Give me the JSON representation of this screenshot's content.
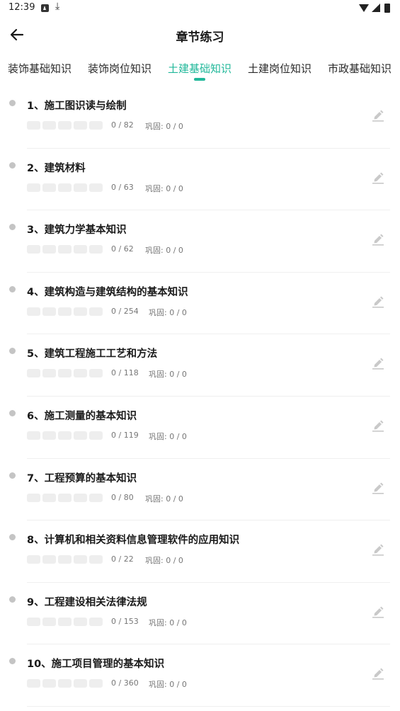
{
  "status_bar": {
    "time": "12:39"
  },
  "header": {
    "title": "章节练习"
  },
  "tabs": [
    {
      "label": "装饰基础知识",
      "active": false
    },
    {
      "label": "装饰岗位知识",
      "active": false
    },
    {
      "label": "土建基础知识",
      "active": true
    },
    {
      "label": "土建岗位知识",
      "active": false
    },
    {
      "label": "市政基础知识",
      "active": false
    }
  ],
  "colors": {
    "accent": "#21b89a",
    "dot": "#c4c4c4",
    "progress_bg": "#eeeeee"
  },
  "chapters": [
    {
      "title": "1、施工图识读与绘制",
      "count": "0 / 82",
      "consolidate": "巩固: 0 / 0"
    },
    {
      "title": "2、建筑材料",
      "count": "0 / 63",
      "consolidate": "巩固: 0 / 0"
    },
    {
      "title": "3、建筑力学基本知识",
      "count": "0 / 62",
      "consolidate": "巩固: 0 / 0"
    },
    {
      "title": "4、建筑构造与建筑结构的基本知识",
      "count": "0 / 254",
      "consolidate": "巩固: 0 / 0"
    },
    {
      "title": "5、建筑工程施工工艺和方法",
      "count": "0 / 118",
      "consolidate": "巩固: 0 / 0"
    },
    {
      "title": "6、施工测量的基本知识",
      "count": "0 / 119",
      "consolidate": "巩固: 0 / 0"
    },
    {
      "title": "7、工程预算的基本知识",
      "count": "0 / 80",
      "consolidate": "巩固: 0 / 0"
    },
    {
      "title": "8、计算机和相关资料信息管理软件的应用知识",
      "count": "0 / 22",
      "consolidate": "巩固: 0 / 0"
    },
    {
      "title": "9、工程建设相关法律法规",
      "count": "0 / 153",
      "consolidate": "巩固: 0 / 0"
    },
    {
      "title": "10、施工项目管理的基本知识",
      "count": "0 / 360",
      "consolidate": "巩固: 0 / 0"
    }
  ]
}
